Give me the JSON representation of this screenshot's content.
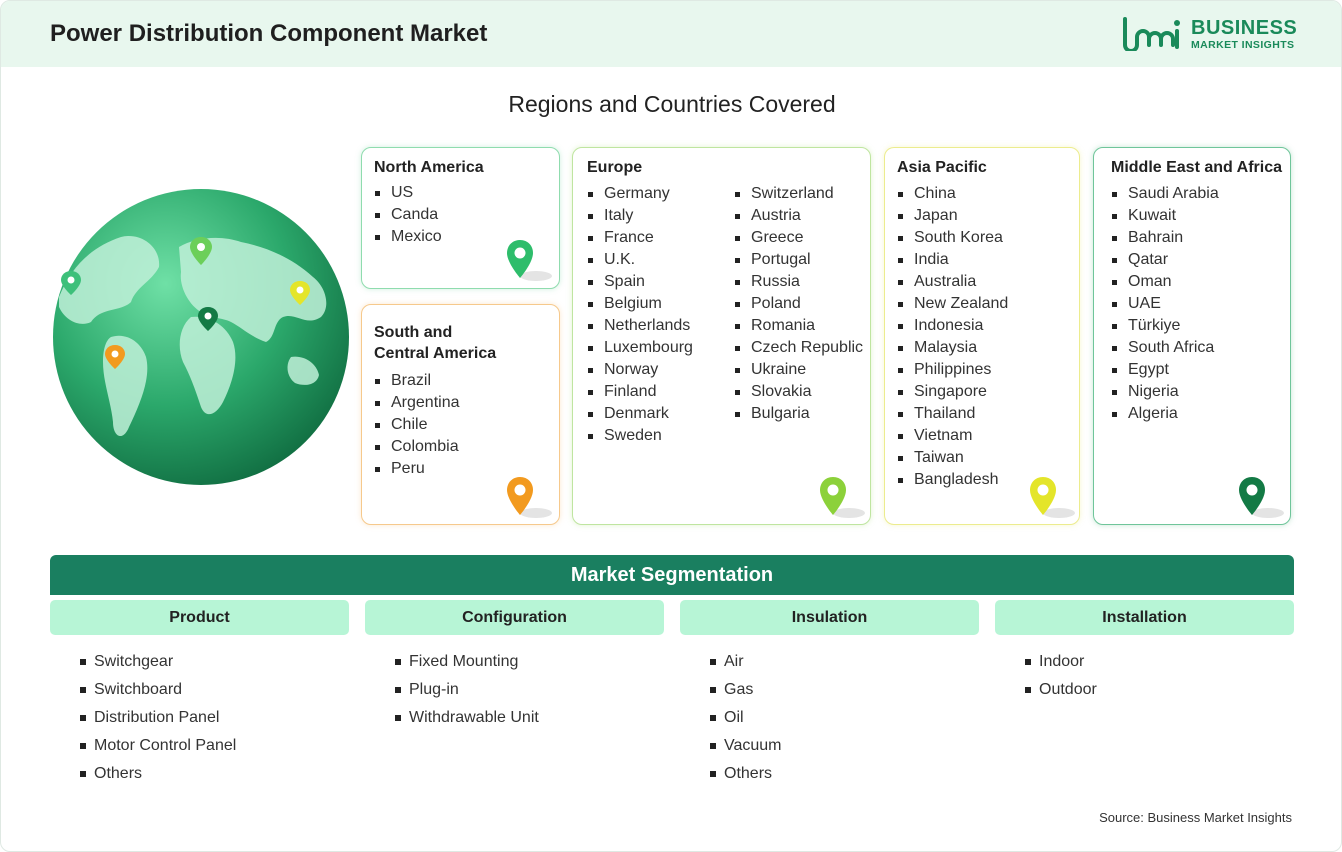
{
  "header": {
    "title": "Power Distribution Component Market",
    "logo_line1": "BUSINESS",
    "logo_line2": "MARKET INSIGHTS"
  },
  "regions_title": "Regions and Countries Covered",
  "regions": {
    "north_america": {
      "title": "North America",
      "items": [
        "US",
        "Canda",
        "Mexico"
      ],
      "pin_color": "#2ebd6b"
    },
    "south_central_america": {
      "title_line1": "South and",
      "title_line2": "Central America",
      "items": [
        "Brazil",
        "Argentina",
        "Chile",
        "Colombia",
        "Peru"
      ],
      "pin_color": "#f29a1f"
    },
    "europe": {
      "title": "Europe",
      "col1": [
        "Germany",
        "Italy",
        "France",
        "U.K.",
        "Spain",
        "Belgium",
        "Netherlands",
        "Luxembourg",
        "Norway",
        "Finland",
        "Denmark",
        "Sweden"
      ],
      "col2": [
        "Switzerland",
        "Austria",
        "Greece",
        "Portugal",
        "Russia",
        "Poland",
        "Romania",
        "Czech Republic",
        "Ukraine",
        "Slovakia",
        "Bulgaria"
      ],
      "pin_color": "#8cd13a"
    },
    "asia_pacific": {
      "title": "Asia Pacific",
      "items": [
        "China",
        "Japan",
        "South Korea",
        "India",
        "Australia",
        "New Zealand",
        "Indonesia",
        "Malaysia",
        "Philippines",
        "Singapore",
        "Thailand",
        "Vietnam",
        "Taiwan",
        "Bangladesh"
      ],
      "pin_color": "#e4e52a"
    },
    "middle_east_africa": {
      "title": "Middle East and Africa",
      "items": [
        "Saudi Arabia",
        "Kuwait",
        "Bahrain",
        "Qatar",
        "Oman",
        "UAE",
        "Türkiye",
        "South Africa",
        "Egypt",
        "Nigeria",
        "Algeria"
      ],
      "pin_color": "#137a45"
    }
  },
  "segmentation": {
    "title": "Market Segmentation",
    "columns": [
      {
        "header": "Product",
        "items": [
          "Switchgear",
          "Switchboard",
          "Distribution Panel",
          "Motor Control Panel",
          "Others"
        ]
      },
      {
        "header": "Configuration",
        "items": [
          "Fixed Mounting",
          "Plug-in",
          "Withdrawable Unit"
        ]
      },
      {
        "header": "Insulation",
        "items": [
          "Air",
          "Gas",
          "Oil",
          "Vacuum",
          "Others"
        ]
      },
      {
        "header": "Installation",
        "items": [
          "Indoor",
          "Outdoor"
        ]
      }
    ]
  },
  "source": "Source: Business Market Insights",
  "colors": {
    "brand": "#1a8a5a",
    "seg_bar": "#1a7f60",
    "seg_head": "#b7f5d6",
    "header_bg": "#e8f7ee"
  }
}
